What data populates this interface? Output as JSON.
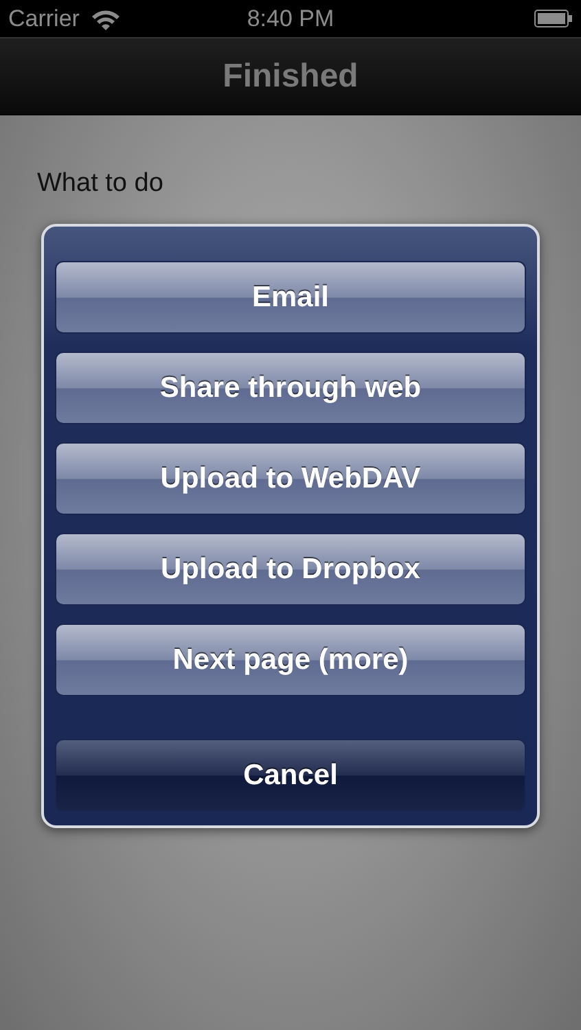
{
  "status_bar": {
    "carrier": "Carrier",
    "time": "8:40 PM"
  },
  "nav_bar": {
    "title": "Finished"
  },
  "sections": [
    {
      "title": "What to do"
    }
  ],
  "action_sheet": {
    "buttons": [
      {
        "label": "Email",
        "kind": "default"
      },
      {
        "label": "Share through web",
        "kind": "default"
      },
      {
        "label": "Upload to WebDAV",
        "kind": "default"
      },
      {
        "label": "Upload to Dropbox",
        "kind": "default"
      },
      {
        "label": "Next page (more)",
        "kind": "default"
      },
      {
        "label": "Cancel",
        "kind": "cancel"
      }
    ]
  }
}
